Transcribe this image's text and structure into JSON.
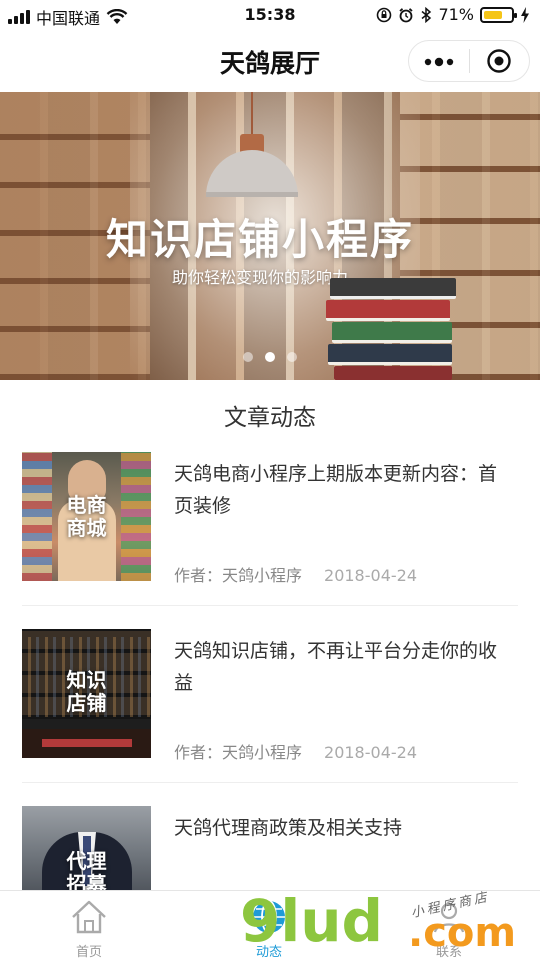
{
  "status_bar": {
    "carrier": "中国联通",
    "time": "15:38",
    "battery": "71%",
    "battery_level": 0.71
  },
  "navbar": {
    "title": "天鸽展厅"
  },
  "banner": {
    "title": "知识店铺小程序",
    "subtitle": "助你轻松变现你的影响力",
    "slide_count": 3,
    "active_slide": 2
  },
  "section": {
    "title": "文章动态"
  },
  "articles": [
    {
      "thumb_label": "电商\n商城",
      "title": "天鸽电商小程序上期版本更新内容：首页装修",
      "author": "作者：天鸽小程序",
      "date": "2018-04-24"
    },
    {
      "thumb_label": "知识\n店铺",
      "title": "天鸽知识店铺，不再让平台分走你的收益",
      "author": "作者：天鸽小程序",
      "date": "2018-04-24"
    },
    {
      "thumb_label": "代理\n招募",
      "title": "天鸽代理商政策及相关支持",
      "author": "",
      "date": ""
    }
  ],
  "tabbar": {
    "items": [
      {
        "label": "首页",
        "icon": "home-icon",
        "active": false
      },
      {
        "label": "动态",
        "icon": "globe-icon",
        "active": true
      },
      {
        "label": "联系",
        "icon": "contact-icon",
        "active": false
      }
    ]
  },
  "watermark": {
    "brand": "9lud",
    "domain": ".com",
    "tagline": "小程序商店"
  },
  "colors": {
    "accent": "#1e9bd7",
    "battery": "#f5c518",
    "watermark_green": "#8dc63f",
    "watermark_orange": "#f39a1e"
  }
}
